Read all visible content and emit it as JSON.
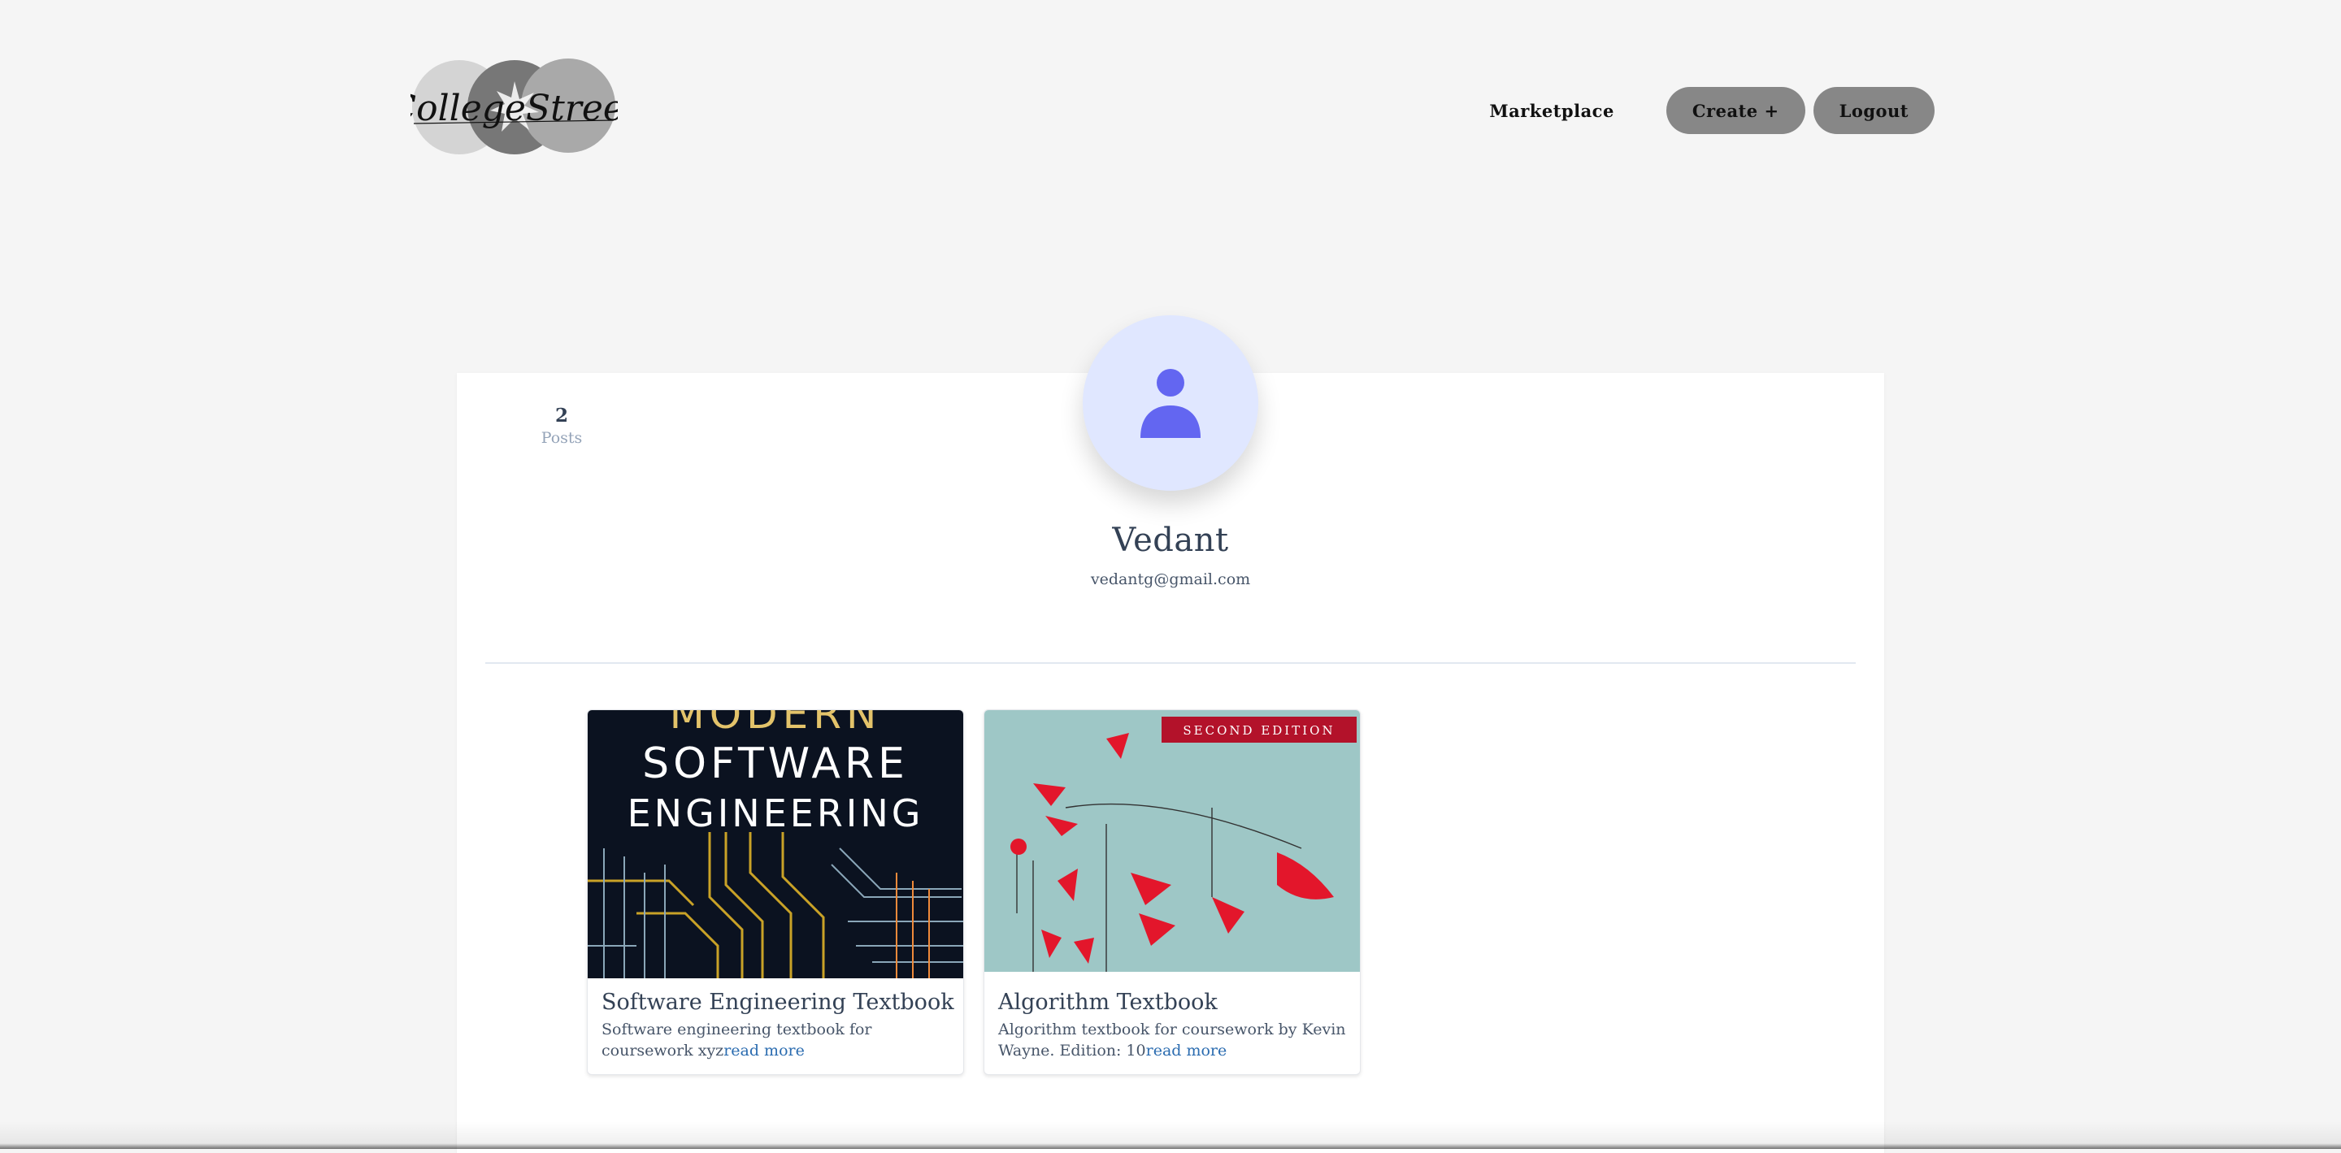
{
  "header": {
    "logo_text": "CollegeStreet",
    "nav": {
      "marketplace": "Marketplace",
      "create": "Create +",
      "logout": "Logout"
    }
  },
  "profile": {
    "posts_count": "2",
    "posts_label": "Posts",
    "name": "Vedant",
    "email": "vedantg@gmail.com",
    "avatar_icon": "user-icon"
  },
  "posts": [
    {
      "title": "Software Engineering Textbook",
      "description": "Software engineering textbook for coursework xyz",
      "read_more": "read more",
      "cover_lines": [
        "MODERN",
        "SOFTWARE",
        "ENGINEERING"
      ]
    },
    {
      "title": "Algorithm Textbook",
      "description": "Algorithm textbook for coursework by Kevin Wayne. Edition: 10",
      "read_more": "read more",
      "cover_banner": "SECOND EDITION"
    }
  ],
  "colors": {
    "background": "#f5f5f5",
    "button": "#878787",
    "avatar_bg": "#e0e7ff",
    "avatar_icon": "#6366f1",
    "link": "#2b6cb0"
  }
}
